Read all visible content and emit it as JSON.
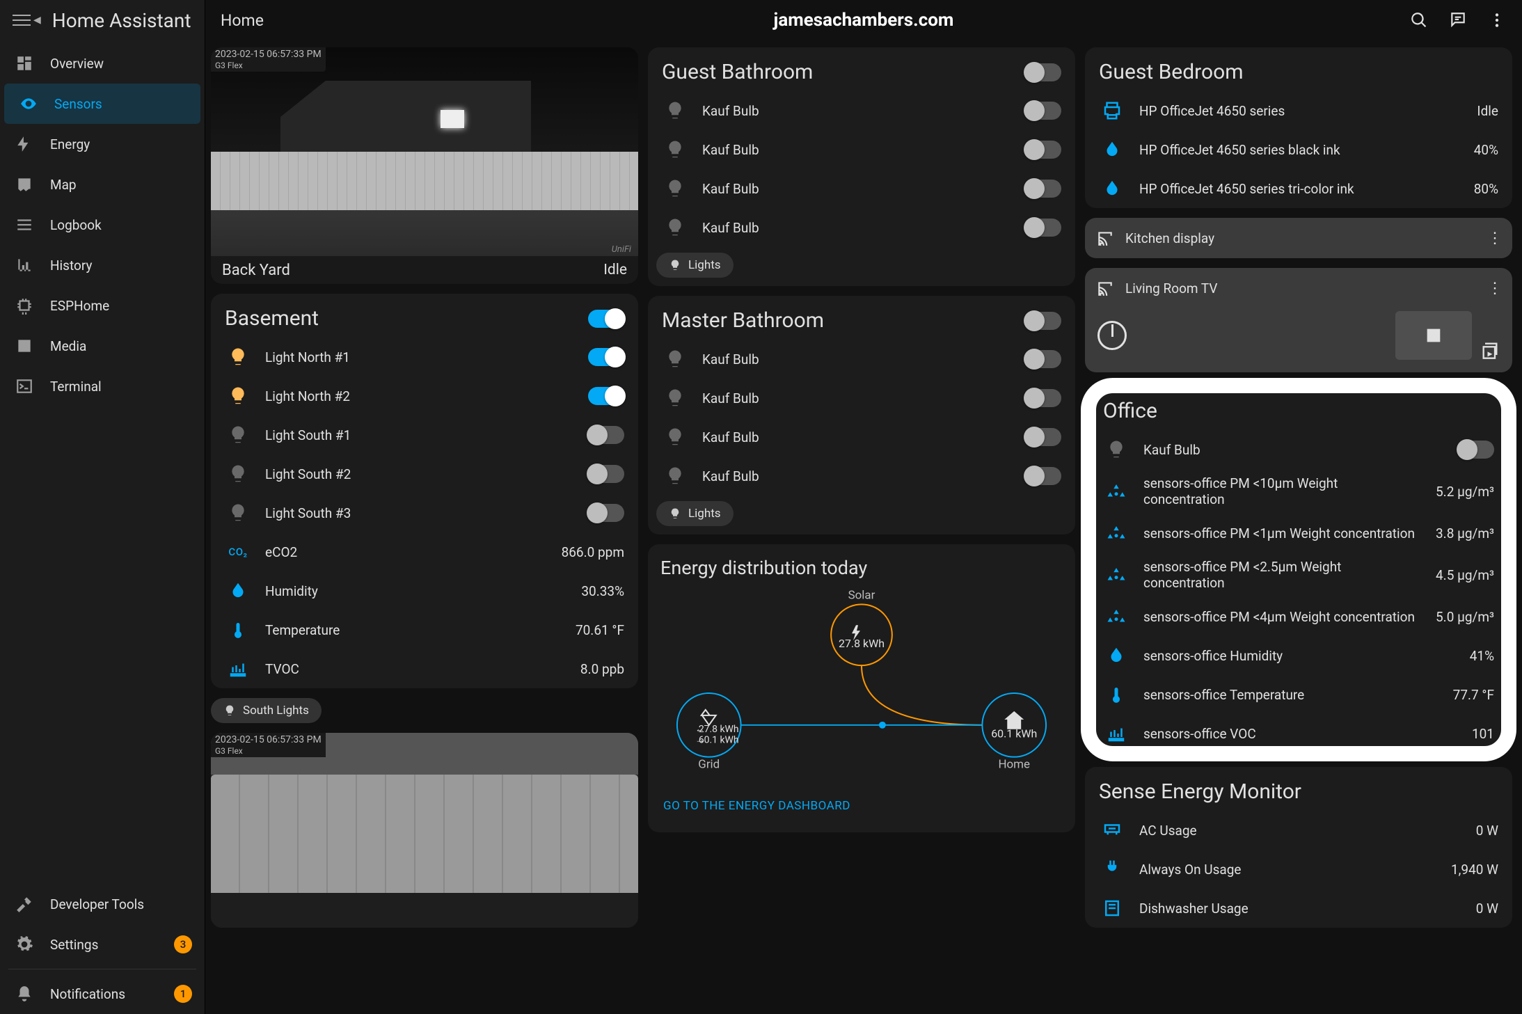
{
  "app": {
    "name": "Home Assistant",
    "crumb": "Home",
    "center": "jamesachambers.com"
  },
  "sidebar": {
    "items": [
      {
        "id": "overview",
        "label": "Overview"
      },
      {
        "id": "sensors",
        "label": "Sensors",
        "active": true
      },
      {
        "id": "energy",
        "label": "Energy"
      },
      {
        "id": "map",
        "label": "Map"
      },
      {
        "id": "logbook",
        "label": "Logbook"
      },
      {
        "id": "history",
        "label": "History"
      },
      {
        "id": "esphome",
        "label": "ESPHome"
      },
      {
        "id": "media",
        "label": "Media"
      },
      {
        "id": "terminal",
        "label": "Terminal"
      }
    ],
    "bottom": [
      {
        "id": "devtools",
        "label": "Developer Tools"
      },
      {
        "id": "settings",
        "label": "Settings",
        "badge": "3"
      },
      {
        "id": "notifications",
        "label": "Notifications",
        "badge": "1"
      }
    ]
  },
  "camera1": {
    "timestamp": "2023-02-15 06:57:33 PM",
    "device": "G3 Flex",
    "name": "Back Yard",
    "state": "Idle",
    "brand": "UniFi"
  },
  "camera2": {
    "timestamp": "2023-02-15 06:57:33 PM",
    "device": "G3 Flex"
  },
  "basement": {
    "title": "Basement",
    "master_on": true,
    "lights": [
      {
        "label": "Light North #1",
        "on": true
      },
      {
        "label": "Light North #2",
        "on": true
      },
      {
        "label": "Light South #1",
        "on": false
      },
      {
        "label": "Light South #2",
        "on": false
      },
      {
        "label": "Light South #3",
        "on": false
      }
    ],
    "sensors": [
      {
        "type": "co2",
        "label": "eCO2",
        "value": "866.0 ppm"
      },
      {
        "type": "humidity",
        "label": "Humidity",
        "value": "30.33%"
      },
      {
        "type": "temperature",
        "label": "Temperature",
        "value": "70.61 °F"
      },
      {
        "type": "tvoc",
        "label": "TVOC",
        "value": "8.0 ppb"
      }
    ],
    "chip": "South Lights"
  },
  "guest_bathroom": {
    "title": "Guest Bathroom",
    "master_on": false,
    "bulbs": [
      {
        "label": "Kauf Bulb"
      },
      {
        "label": "Kauf Bulb"
      },
      {
        "label": "Kauf Bulb"
      },
      {
        "label": "Kauf Bulb"
      }
    ],
    "chip": "Lights"
  },
  "master_bathroom": {
    "title": "Master Bathroom",
    "master_on": false,
    "bulbs": [
      {
        "label": "Kauf Bulb"
      },
      {
        "label": "Kauf Bulb"
      },
      {
        "label": "Kauf Bulb"
      },
      {
        "label": "Kauf Bulb"
      }
    ],
    "chip": "Lights"
  },
  "energy": {
    "title": "Energy distribution today",
    "solar": {
      "label": "Solar",
      "value": "27.8 kWh"
    },
    "grid": {
      "label": "Grid",
      "in": "27.8 kWh",
      "out": "60.1 kWh"
    },
    "home": {
      "label": "Home",
      "value": "60.1 kWh"
    },
    "link": "GO TO THE ENERGY DASHBOARD"
  },
  "guest_bedroom": {
    "title": "Guest Bedroom",
    "rows": [
      {
        "type": "printer",
        "label": "HP OfficeJet 4650 series",
        "value": "Idle"
      },
      {
        "type": "ink",
        "label": "HP OfficeJet 4650 series black ink",
        "value": "40%"
      },
      {
        "type": "ink",
        "label": "HP OfficeJet 4650 series tri-color ink",
        "value": "80%"
      }
    ]
  },
  "media_kitchen": {
    "title": "Kitchen display"
  },
  "media_lr": {
    "title": "Living Room TV"
  },
  "office": {
    "title": "Office",
    "bulb": {
      "label": "Kauf Bulb",
      "on": false
    },
    "sensors": [
      {
        "type": "pm",
        "label": "sensors-office PM <10µm Weight concentration",
        "value": "5.2 µg/m³"
      },
      {
        "type": "pm",
        "label": "sensors-office PM <1µm Weight concentration",
        "value": "3.8 µg/m³"
      },
      {
        "type": "pm",
        "label": "sensors-office PM <2.5µm Weight concentration",
        "value": "4.5 µg/m³"
      },
      {
        "type": "pm",
        "label": "sensors-office PM <4µm Weight concentration",
        "value": "5.0 µg/m³"
      },
      {
        "type": "humidity",
        "label": "sensors-office Humidity",
        "value": "41%"
      },
      {
        "type": "temperature",
        "label": "sensors-office Temperature",
        "value": "77.7 °F"
      },
      {
        "type": "tvoc",
        "label": "sensors-office VOC",
        "value": "101"
      }
    ]
  },
  "sense": {
    "title": "Sense Energy Monitor",
    "rows": [
      {
        "type": "ac",
        "label": "AC Usage",
        "value": "0 W"
      },
      {
        "type": "plug",
        "label": "Always On Usage",
        "value": "1,940 W"
      },
      {
        "type": "dish",
        "label": "Dishwasher Usage",
        "value": "0 W"
      }
    ]
  }
}
